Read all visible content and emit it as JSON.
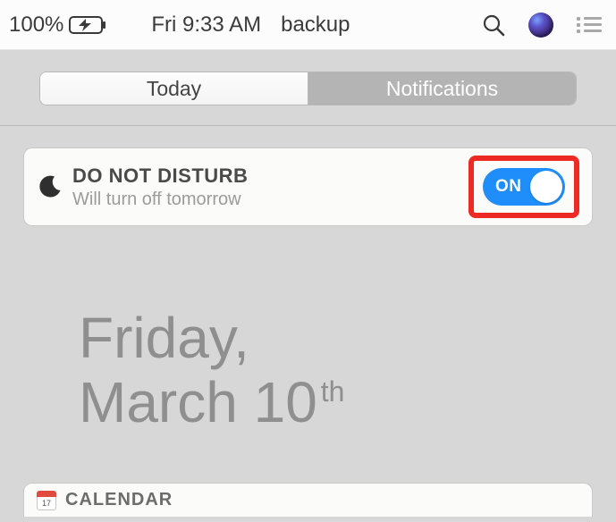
{
  "menubar": {
    "battery_percent": "100%",
    "clock": "Fri 9:33 AM",
    "app_name": "backup"
  },
  "tabs": {
    "today": "Today",
    "notifications": "Notifications",
    "active": "today"
  },
  "dnd": {
    "title": "DO NOT DISTURB",
    "subtitle": "Will turn off tomorrow",
    "toggle_label": "ON",
    "toggle_on": true
  },
  "date": {
    "line1": "Friday,",
    "line2_prefix": "March 10",
    "line2_suffix": "th"
  },
  "calendar": {
    "header": "CALENDAR",
    "icon_day": "17"
  }
}
